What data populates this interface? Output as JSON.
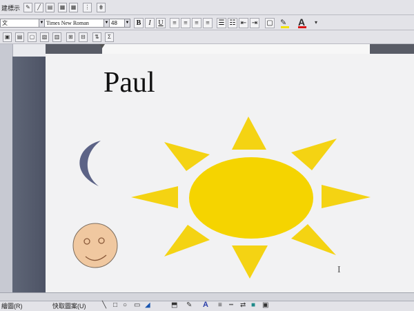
{
  "toolbar_standard": {
    "left_label": "建標示"
  },
  "formatting_toolbar": {
    "style_value": "文",
    "font_name": "Times New Roman",
    "font_size": "48",
    "bold_label": "B",
    "italic_label": "I",
    "underline_label": "U",
    "font_color_label": "A",
    "highlight_color": "#f2e200",
    "font_color": "#d81414"
  },
  "document": {
    "title": "Paul",
    "sun_body_color": "#f5d400",
    "sun_ray_color": "#f4d313",
    "moon_color": "#5c6386",
    "face_color": "#f0c8a0"
  },
  "drawing_toolbar": {
    "draw_label": "繪圖(R)",
    "autoshape_label": "快取圖案(U)"
  }
}
